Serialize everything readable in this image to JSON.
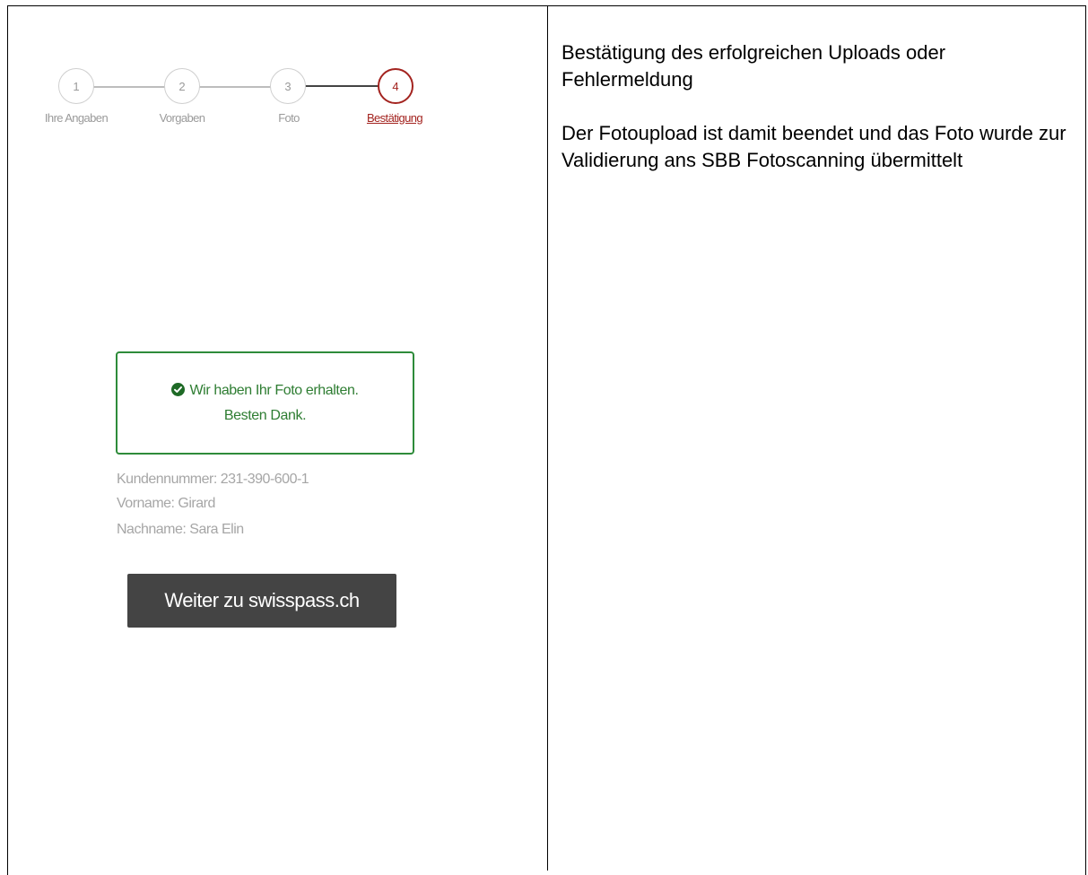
{
  "stepper": {
    "steps": [
      {
        "number": "1",
        "label": "Ihre Angaben"
      },
      {
        "number": "2",
        "label": "Vorgaben"
      },
      {
        "number": "3",
        "label": "Foto"
      },
      {
        "number": "4",
        "label": "Bestätigung"
      }
    ],
    "active_step": 4
  },
  "confirmation": {
    "line1": "Wir haben Ihr Foto erhalten.",
    "line2": "Besten Dank.",
    "icon": "check-circle-icon"
  },
  "customer": {
    "number": "Kundennummer: 231-390-600-1",
    "firstname": "Vorname: Girard",
    "lastname": "Nachname: Sara Elin"
  },
  "cta": {
    "label": "Weiter zu swisspass.ch"
  },
  "description": {
    "paragraph1": "Bestätigung des erfolgreichen Uploads oder Fehlermeldung",
    "paragraph2": "Der Fotoupload ist damit beendet und das Foto wurde zur Validierung ans SBB Fotoscanning übermittelt"
  },
  "colors": {
    "accent": "#a3231f",
    "success": "#2e7d32",
    "button": "#444444"
  }
}
